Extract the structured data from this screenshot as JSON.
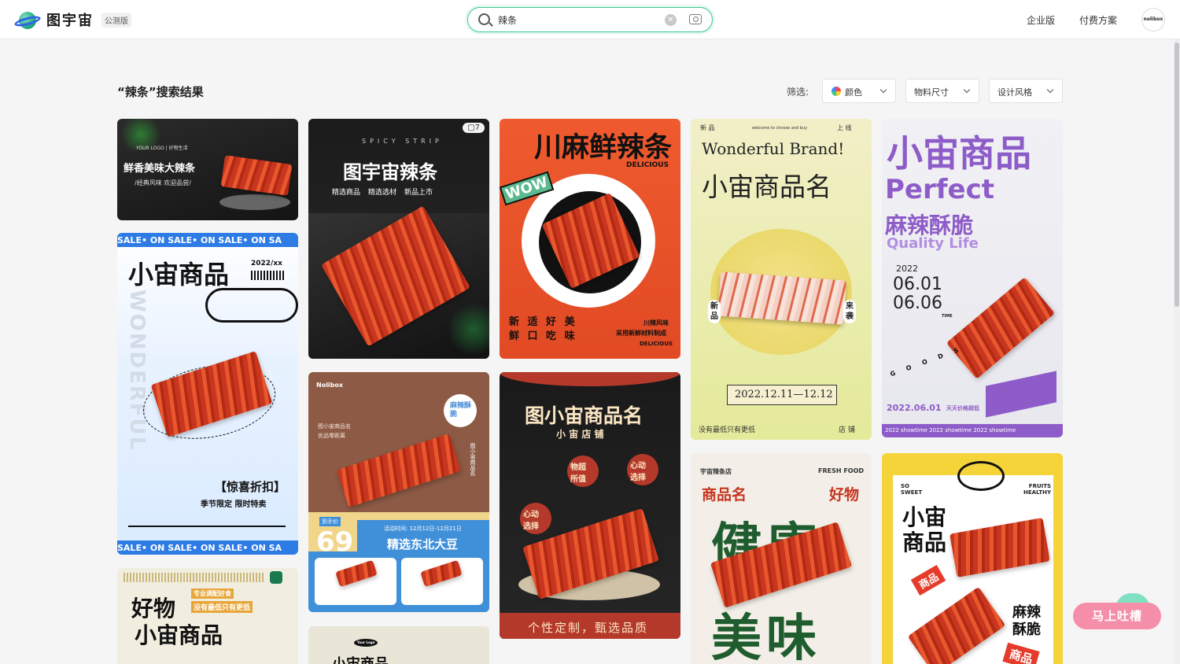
{
  "header": {
    "logo_text": "图宇宙",
    "beta_label": "公测版",
    "search": {
      "value": "辣条",
      "placeholder": ""
    },
    "nav": [
      "企业版",
      "付费方案"
    ],
    "avatar_text": "nolibox"
  },
  "results": {
    "title": "“辣条”搜索结果",
    "filter_label": "筛选:",
    "filters": [
      "颜色",
      "物料尺寸",
      "设计风格"
    ]
  },
  "cards": {
    "c1": {
      "title": "鲜香美味大辣条",
      "subtitle": "/经典风味 欢迎品尝/",
      "logo": "YOUR LOGO | 好物生活"
    },
    "c2": {
      "tag": "SALE• ON  SALE• ON  SALE• ON  SA",
      "title": "小宙商品",
      "year": "2022/xx",
      "vertical": "WONDERFUL",
      "promo": "【惊喜折扣】",
      "promo_sub": "季节限定  限时特卖",
      "tag_bottom": "SALE• ON  SALE• ON  SALE• ON  SA"
    },
    "c3": {
      "title": "好物",
      "title2": "小宙商品",
      "note1": "专业调配好食",
      "note2": "没有最低只有更低"
    },
    "c4": {
      "count": "7",
      "top": "SPICY STRIP",
      "title": "图宇宙辣条",
      "tags": [
        "精选商品",
        "精选选材",
        "新品上市"
      ]
    },
    "c5": {
      "brand": "Nolibox",
      "sub1": "图小宙商品名",
      "sub2": "优品零距离",
      "stamp": "麻辣酥脆",
      "price_label": "到手价",
      "price": "69",
      "activity": "活动时间: 12月12日-12月21日",
      "product": "精选东北大豆",
      "side": "图小宙商品名"
    },
    "c6": {
      "logo": "Your Logo",
      "title": "小宙商品"
    },
    "c7": {
      "title": "川麻鲜辣条",
      "sub": "DELICIOUS",
      "wow": "WOW",
      "grid": "新 适 好 美\n鲜 口 吃 味",
      "right1": "川辣风味",
      "right2": "采用新鲜材料制成",
      "right3": "DELICIOUS"
    },
    "c8": {
      "title": "图小宙商品名",
      "sub": "小 宙 店 铺",
      "bubble1": "物超\n所值",
      "bubble2": "心动\n选择",
      "bubble3": "心动\n选择",
      "footer": "个性定制，甄选品质"
    },
    "c9": {
      "top_left": "新  品",
      "top_center": "welcome to choose and buy",
      "top_right": "上  线",
      "title_en": "Wonderful Brand!",
      "title": "小宙商品名",
      "left_tag": "新\n品",
      "right_tag": "来\n袭",
      "date": "2022.12.11—12.12",
      "footer": "没有最低只有更低",
      "footer_right": "店  铺"
    },
    "c10": {
      "shop": "宇宙辣条店",
      "fresh": "FRESH FOOD",
      "name": "商品名",
      "good": "好物",
      "big1": "健康",
      "big2": "美味"
    },
    "c11": {
      "title": "小宙商品",
      "en": "Perfect",
      "title2": "麻辣酥脆",
      "en2": "Quality Life",
      "year": "2022",
      "date1": "06.01",
      "date2": "06.06",
      "time": "TIME",
      "goods": "G O O D S",
      "bottom": "2022.06.01",
      "bottom_note": "天天价格超低",
      "footer": "2022 showtime    2022 showtime    2022 showtime"
    },
    "c12": {
      "so": "SO\nSWEET",
      "fruits": "FRUITS\nHEALTHY",
      "title": "小宙\n商品",
      "tag1": "商品",
      "tag2": "麻辣\n酥脆",
      "tag3": "商品"
    }
  },
  "feedback": "马上吐槽",
  "colors": {
    "accent": "#3cc78f",
    "feedback": "#f58fa9",
    "brand_ring": "#2f62e8"
  },
  "icons": [
    "search-icon",
    "clear-icon",
    "camera-icon",
    "chevron-down-icon",
    "color-wheel-icon",
    "layers-icon"
  ]
}
